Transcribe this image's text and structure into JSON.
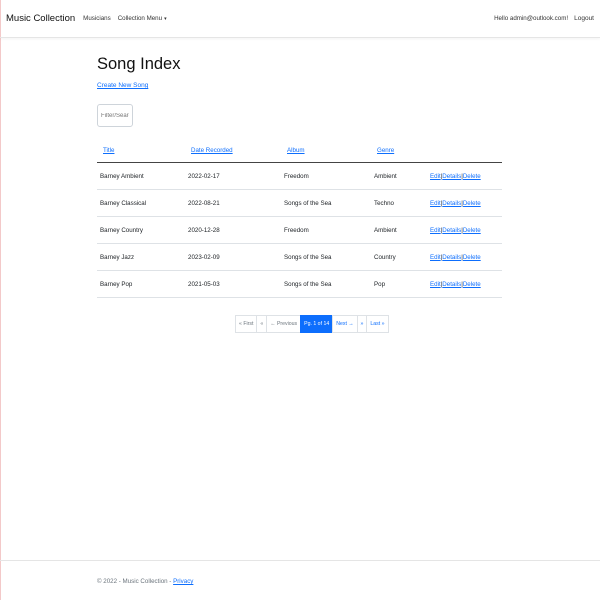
{
  "nav": {
    "brand": "Music Collection",
    "musicians": "Musicians",
    "collection_menu": "Collection Menu",
    "caret": "▾",
    "hello": "Hello admin@outlook.com!",
    "logout": "Logout"
  },
  "page": {
    "title": "Song Index",
    "create_link": "Create New Song",
    "filter_placeholder": "Filter/Search"
  },
  "table": {
    "headers": [
      "Title",
      "Date Recorded",
      "Album",
      "Genre"
    ],
    "rows": [
      {
        "title": "Barney Ambient",
        "date": "2022-02-17",
        "album": "Freedom",
        "genre": "Ambient"
      },
      {
        "title": "Barney Classical",
        "date": "2022-08-21",
        "album": "Songs of the Sea",
        "genre": "Techno"
      },
      {
        "title": "Barney Country",
        "date": "2020-12-28",
        "album": "Freedom",
        "genre": "Ambient"
      },
      {
        "title": "Barney Jazz",
        "date": "2023-02-09",
        "album": "Songs of the Sea",
        "genre": "Country"
      },
      {
        "title": "Barney Pop",
        "date": "2021-05-03",
        "album": "Songs of the Sea",
        "genre": "Pop"
      }
    ],
    "actions": {
      "edit": "Edit",
      "details": "Details",
      "delete": "Delete",
      "separator": "|"
    }
  },
  "pager": {
    "first": "« First",
    "prev_icon": "«",
    "previous": "← Previous",
    "current": "Pg. 1 of 14",
    "next": "Next →",
    "next_icon": "»",
    "last": "Last »"
  },
  "footer": {
    "text": "© 2022 - Music Collection - ",
    "privacy": "Privacy"
  }
}
